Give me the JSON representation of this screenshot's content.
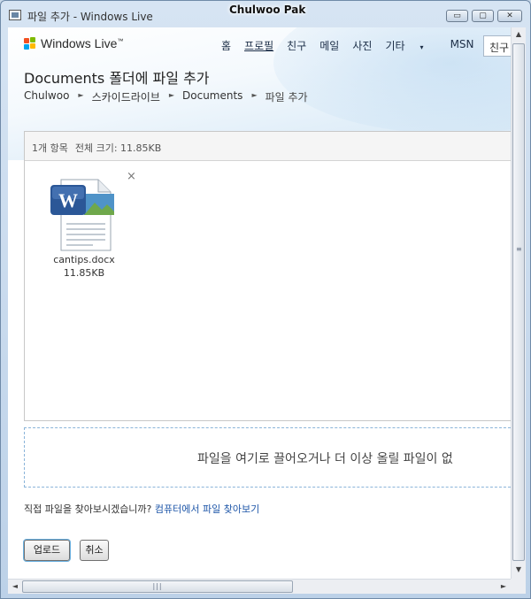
{
  "window": {
    "title": "파일 추가 - Windows Live",
    "user_name": "Chulwoo Pak",
    "minimize_glyph": "▭",
    "maximize_glyph": "▢",
    "close_glyph": "✕"
  },
  "header": {
    "logo_text": "Windows Live",
    "logo_mark": "™",
    "nav": [
      {
        "label": "홈"
      },
      {
        "label": "프로필"
      },
      {
        "label": "친구"
      },
      {
        "label": "메일"
      },
      {
        "label": "사진"
      },
      {
        "label": "기타",
        "caret": "▾"
      },
      {
        "label": "MSN",
        "caret": "▾"
      }
    ],
    "search_value": "친구"
  },
  "page": {
    "title": "Documents 폴더에 파일 추가",
    "breadcrumb": [
      "Chulwoo",
      "스카이드라이브",
      "Documents",
      "파일 추가"
    ],
    "breadcrumb_sep": "►"
  },
  "panel": {
    "count": "1개 항목",
    "total_size": "전체 크기: 11.85KB",
    "files": [
      {
        "name": "cantips.docx",
        "size": "11.85KB",
        "icon": "word-document-icon"
      }
    ],
    "remove_glyph": "×"
  },
  "dropzone": {
    "text": "파일을 여기로 끌어오거나 더 이상 올릴 파일이 없"
  },
  "browse": {
    "prompt": "직접 파일을 찾아보시겠습니까?",
    "link": "컴퓨터에서 파일 찾아보기"
  },
  "buttons": {
    "upload": "업로드",
    "cancel": "취소"
  },
  "colors": {
    "link": "#1e56a8",
    "dropzone_border": "#8ab4d9",
    "word_blue": "#2b5797"
  }
}
